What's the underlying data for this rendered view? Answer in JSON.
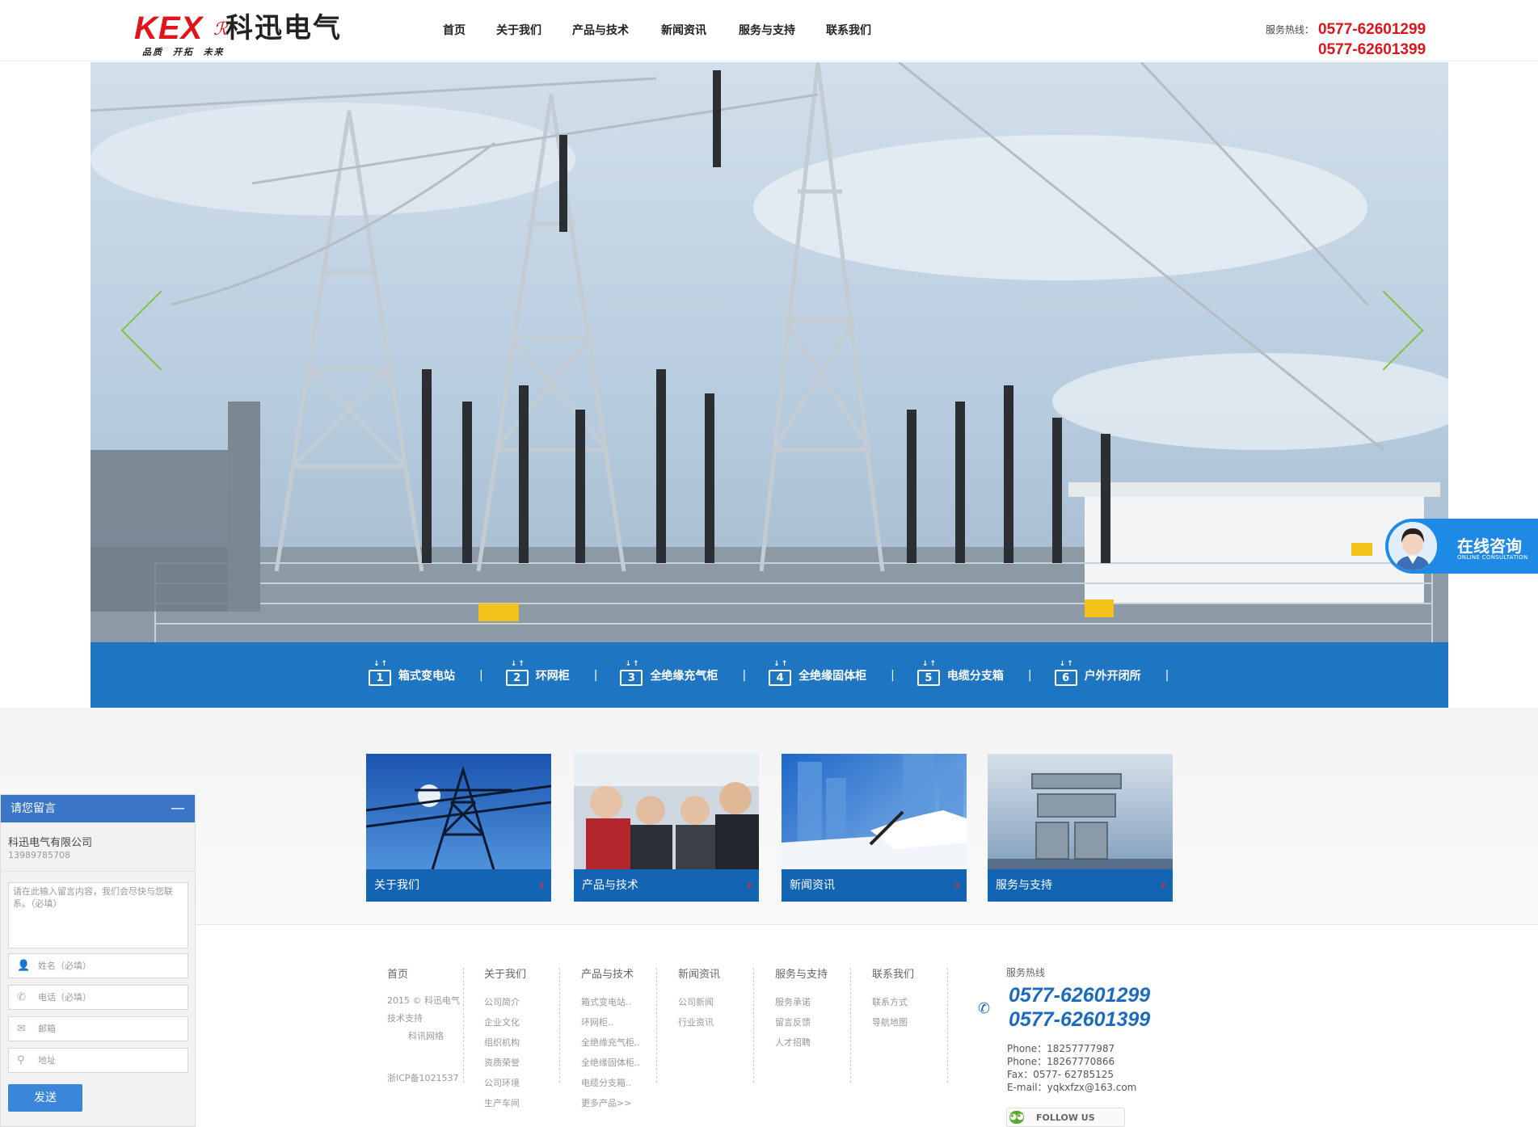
{
  "header": {
    "logo": {
      "mark": "KEX",
      "cn": "科迅电气",
      "slogan": "品质 开拓 未来"
    },
    "nav": [
      "首页",
      "关于我们",
      "产品与技术",
      "新闻资讯",
      "服务与支持",
      "联系我们"
    ],
    "hotline_label": "服务热线：",
    "hotline_numbers": [
      "0577-62601299",
      "0577-62601399"
    ]
  },
  "banner": {
    "categories": [
      {
        "num": "1",
        "label": "箱式变电站"
      },
      {
        "num": "2",
        "label": "环网柜"
      },
      {
        "num": "3",
        "label": "全绝缘充气柜"
      },
      {
        "num": "4",
        "label": "全绝缘固体柜"
      },
      {
        "num": "5",
        "label": "电缆分支箱"
      },
      {
        "num": "6",
        "label": "户外开闭所"
      }
    ],
    "separator": "|"
  },
  "consult": {
    "title": "在线咨询",
    "subtitle": "ONLINE CONSULTATION"
  },
  "cards": [
    {
      "label": "关于我们"
    },
    {
      "label": "产品与技术"
    },
    {
      "label": "新闻资讯"
    },
    {
      "label": "服务与支持"
    }
  ],
  "footer": {
    "columns": [
      {
        "head": "首页",
        "items": [
          "2015 © 科迅电气",
          "技术支持",
          "科讯网络",
          "",
          "浙ICP备1021537"
        ]
      },
      {
        "head": "关于我们",
        "items": [
          "公司简介",
          "企业文化",
          "组织机构",
          "资质荣誉",
          "公司环境",
          "生产车间"
        ]
      },
      {
        "head": "产品与技术",
        "items": [
          "箱式变电站..",
          "环网柜..",
          "全绝缘充气柜..",
          "全绝缘固体柜..",
          "电缆分支箱..",
          "更多产品>>"
        ]
      },
      {
        "head": "新闻资讯",
        "items": [
          "公司新闻",
          "行业资讯"
        ]
      },
      {
        "head": "服务与支持",
        "items": [
          "服务承诺",
          "留言反馈",
          "人才招聘"
        ]
      },
      {
        "head": "联系我们",
        "items": [
          "联系方式",
          "导航地图"
        ]
      }
    ],
    "hotline_label": "服务热线",
    "hotline_numbers": [
      "0577-62601299",
      "0577-62601399"
    ],
    "contact": [
      "Phone：18257777987",
      "Phone：18267770866",
      "Fax：0577- 62785125",
      "E-mail：yqkxfzx@163.com"
    ],
    "follow": "FOLLOW US",
    "wechat_icon": "wechat-icon"
  },
  "message": {
    "title": "请您留言",
    "minimize": "—",
    "company": "科迅电气有限公司",
    "tel": "13989785708",
    "textarea_placeholder": "请在此输入留言内容，我们会尽快与您联系。（必填）",
    "name_placeholder": "姓名（必填）",
    "phone_placeholder": "电话（必填）",
    "email_placeholder": "邮箱",
    "address_placeholder": "地址",
    "send": "发送"
  }
}
